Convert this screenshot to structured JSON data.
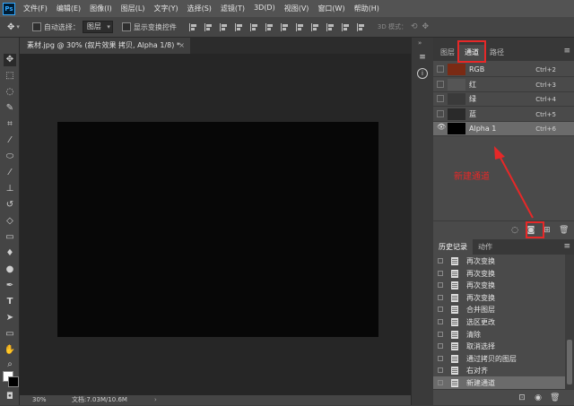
{
  "menubar": {
    "logo": "Ps",
    "items": [
      "文件(F)",
      "编辑(E)",
      "图像(I)",
      "图层(L)",
      "文字(Y)",
      "选择(S)",
      "滤镜(T)",
      "3D(D)",
      "视图(V)",
      "窗口(W)",
      "帮助(H)"
    ]
  },
  "options": {
    "auto_select_label": "自动选择：",
    "auto_select_value": "图层",
    "show_transform_label": "显示变换控件",
    "mode_3d_label": "3D 模式："
  },
  "document": {
    "tab_title": "素材.jpg @ 30% (叙片效果 拷贝, Alpha 1/8) *",
    "close_glyph": "×",
    "zoom": "30%",
    "doc_info": "文档:7.03M/10.6M",
    "canvas_color": "#070707"
  },
  "channels_panel": {
    "tabs": [
      "图层",
      "通道",
      "路径"
    ],
    "active_tab": "通道",
    "menu_glyph": "≡",
    "rows": [
      {
        "name": "RGB",
        "shortcut": "Ctrl+2",
        "visible": false,
        "thumb": "#7a2a14"
      },
      {
        "name": "红",
        "shortcut": "Ctrl+3",
        "visible": false,
        "thumb": "#555555"
      },
      {
        "name": "绿",
        "shortcut": "Ctrl+4",
        "visible": false,
        "thumb": "#3a3a3a"
      },
      {
        "name": "蓝",
        "shortcut": "Ctrl+5",
        "visible": false,
        "thumb": "#2a2a2a"
      },
      {
        "name": "Alpha 1",
        "shortcut": "Ctrl+6",
        "visible": true,
        "thumb": "#000000",
        "selected": true
      }
    ]
  },
  "history_panel": {
    "tabs": [
      "历史记录",
      "动作"
    ],
    "active_tab": "历史记录",
    "menu_glyph": "≡",
    "items": [
      "再次变换",
      "再次变换",
      "再次变换",
      "再次变换",
      "合并图层",
      "选区更改",
      "清除",
      "取消选择",
      "通过拷贝的图层",
      "右对齐",
      "新建通道"
    ],
    "selected_item": "新建通道"
  },
  "annotation": {
    "text": "新建通道",
    "color": "#e62828"
  }
}
